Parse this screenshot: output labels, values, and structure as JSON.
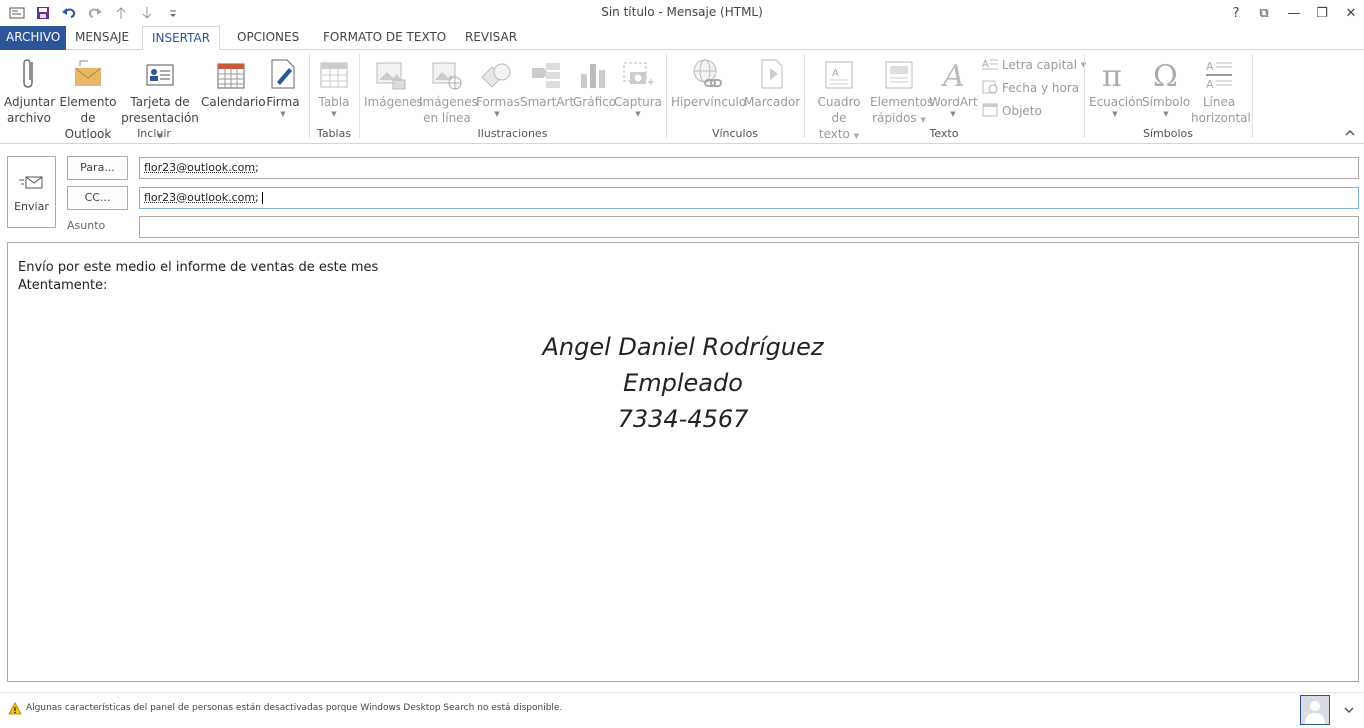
{
  "window": {
    "title": "Sin título - Mensaje (HTML)",
    "help": "?",
    "controls": {
      "restore_ribbon": "⧉",
      "minimize": "—",
      "maximize": "❐",
      "close": "✕"
    }
  },
  "quick_access": [
    "mail-icon",
    "save-icon",
    "undo-icon",
    "redo-icon",
    "up-icon",
    "down-icon",
    "customize-icon"
  ],
  "tabs": [
    {
      "label": "ARCHIVO"
    },
    {
      "label": "MENSAJE"
    },
    {
      "label": "INSERTAR"
    },
    {
      "label": "OPCIONES"
    },
    {
      "label": "FORMATO DE TEXTO"
    },
    {
      "label": "REVISAR"
    }
  ],
  "ribbon": {
    "incluir": {
      "label": "Incluir",
      "adjuntar": [
        "Adjuntar",
        "archivo"
      ],
      "elemento": [
        "Elemento",
        "de Outlook"
      ],
      "tarjeta": [
        "Tarjeta de",
        "presentación"
      ],
      "calendario": "Calendario",
      "firma": "Firma"
    },
    "tablas": {
      "label": "Tablas",
      "tabla": "Tabla"
    },
    "ilustraciones": {
      "label": "Ilustraciones",
      "imagenes": "Imágenes",
      "imagenes_linea": [
        "Imágenes",
        "en línea"
      ],
      "formas": "Formas",
      "smartart": "SmartArt",
      "grafico": "Gráfico",
      "captura": "Captura"
    },
    "vinculos": {
      "label": "Vínculos",
      "hipervinculo": "Hipervínculo",
      "marcador": "Marcador"
    },
    "texto": {
      "label": "Texto",
      "cuadro": [
        "Cuadro de",
        "texto"
      ],
      "elementos": [
        "Elementos",
        "rápidos"
      ],
      "wordart": "WordArt",
      "letra_capital": "Letra capital",
      "fecha_hora": "Fecha y hora",
      "objeto": "Objeto"
    },
    "simbolos": {
      "label": "Símbolos",
      "ecuacion": "Ecuación",
      "simbolo": "Símbolo",
      "linea": [
        "Línea",
        "horizontal"
      ]
    }
  },
  "compose": {
    "send": "Enviar",
    "to_button": "Para...",
    "cc_button": "CC...",
    "subject_label": "Asunto",
    "to_value": "flor23@outlook.com",
    "cc_value": "flor23@outlook.com",
    "separator": ";",
    "subject_value": ""
  },
  "body": {
    "line1": "Envío por este medio el informe de ventas de este mes",
    "line2": "Atentamente:",
    "signature": [
      "Angel Daniel Rodríguez",
      "Empleado",
      "7334-4567"
    ]
  },
  "status": {
    "message": "Algunas características del panel de personas están desactivadas porque Windows Desktop Search no está disponible."
  },
  "colors": {
    "accent": "#2b579a",
    "border": "#ababab",
    "focus": "#7eb4ea"
  }
}
